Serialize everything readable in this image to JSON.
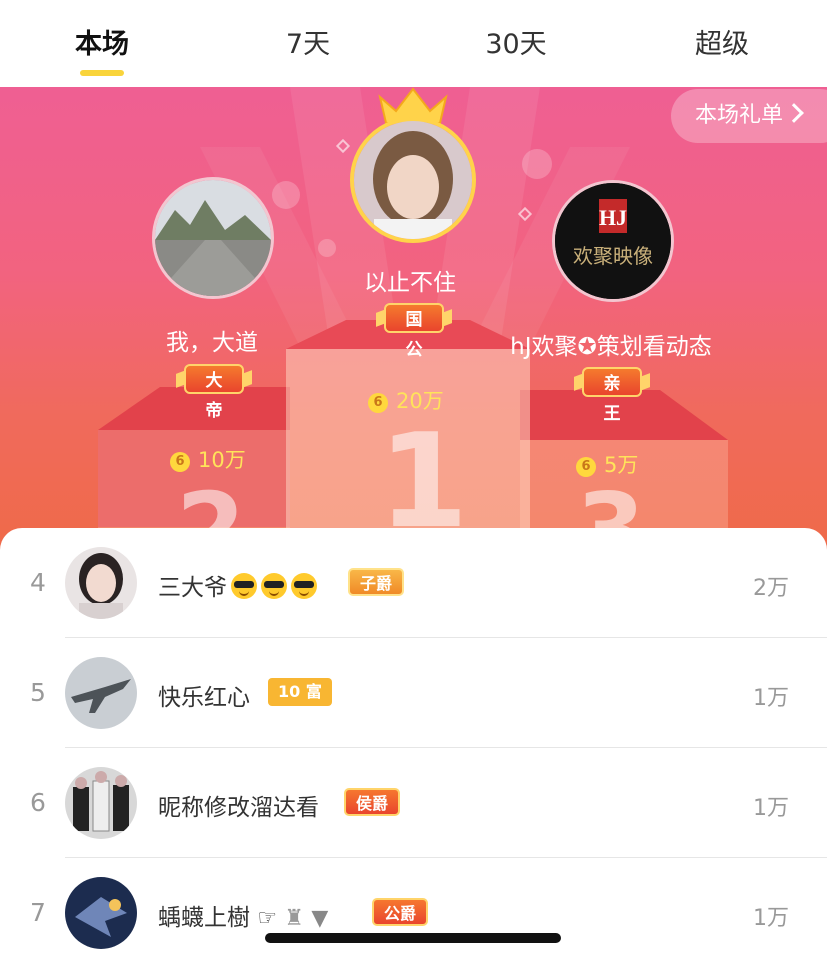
{
  "tabs": [
    {
      "label": "本场",
      "active": true
    },
    {
      "label": "7天",
      "active": false
    },
    {
      "label": "30天",
      "active": false
    },
    {
      "label": "超级",
      "active": false
    }
  ],
  "gift_list_button": "本场礼单",
  "podium": {
    "first": {
      "rank": "1",
      "name": "以止不住",
      "title": "国公",
      "score": "20万"
    },
    "second": {
      "rank": "2",
      "name": "我，大道",
      "title": "大帝",
      "score": "10万"
    },
    "third": {
      "rank": "3",
      "name": "hJ欢聚✪策划看动态",
      "title": "亲王",
      "score": "5万",
      "logo_text": "欢聚映像"
    }
  },
  "coin_symbol": "6",
  "list": [
    {
      "rank": "4",
      "name": "三大爷",
      "emoji_count": 3,
      "badge": "子爵",
      "badge_style": "gold",
      "value": "2万"
    },
    {
      "rank": "5",
      "name": "快乐红心",
      "badge": "10 富",
      "badge_style": "level",
      "value": "1万"
    },
    {
      "rank": "6",
      "name": "昵称修改溜达看",
      "badge": "侯爵",
      "badge_style": "red",
      "value": "1万"
    },
    {
      "rank": "7",
      "name": "蝺蠛上樹",
      "badge": "公爵",
      "badge_style": "red",
      "value": "1万"
    }
  ],
  "colors": {
    "accent": "#f9d43b",
    "podium_top": "#ef5f93",
    "podium_bottom": "#ef6a48",
    "score": "#ffe35a"
  }
}
